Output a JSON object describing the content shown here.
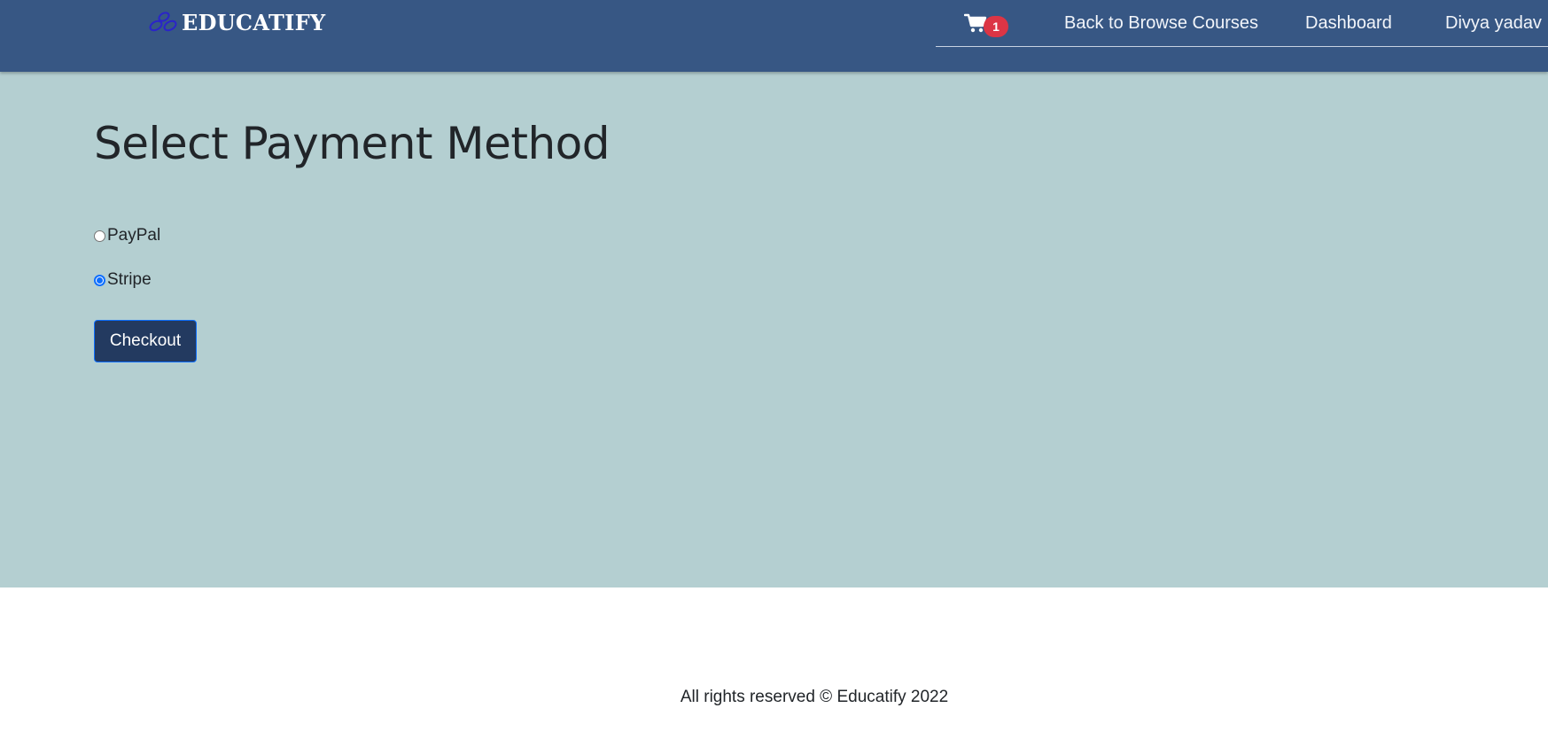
{
  "header": {
    "brand_name": "EDUCATIFY",
    "brand_icon": "triple-ring-logo-icon",
    "cart_icon": "cart-icon",
    "cart_count": "1",
    "nav_links": [
      "Back to Browse Courses",
      "Dashboard",
      "Divya yadav"
    ]
  },
  "main": {
    "title": "Select Payment Method",
    "payment_options": [
      {
        "label": "PayPal",
        "selected": false
      },
      {
        "label": "Stripe",
        "selected": true
      }
    ],
    "checkout_label": "Checkout"
  },
  "footer": {
    "text": "All rights reserved © Educatify 2022"
  },
  "colors": {
    "header_bg": "#375784",
    "hero_bg": "#b4cfd1",
    "button_bg": "#233a60",
    "badge_bg": "#dc3545",
    "accent": "#0d6efd"
  }
}
